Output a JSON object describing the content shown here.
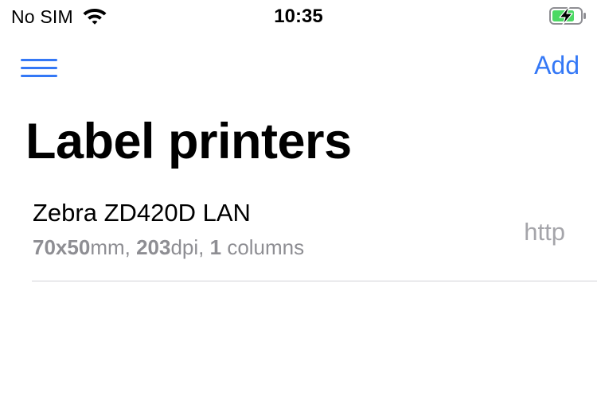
{
  "status_bar": {
    "carrier": "No SIM",
    "time": "10:35",
    "wifi_icon": "wifi-icon",
    "battery_icon": "battery-charging-icon",
    "battery_color": "#4cd964"
  },
  "nav": {
    "menu_icon": "hamburger-menu-icon",
    "add_label": "Add",
    "accent_color": "#3478f6"
  },
  "title": "Label printers",
  "printers": [
    {
      "name": "Zebra ZD420D LAN",
      "size_value": "70x50",
      "size_unit": "mm, ",
      "dpi_value": "203",
      "dpi_unit": "dpi, ",
      "columns_value": "1",
      "columns_unit": " columns",
      "protocol": "http"
    }
  ]
}
